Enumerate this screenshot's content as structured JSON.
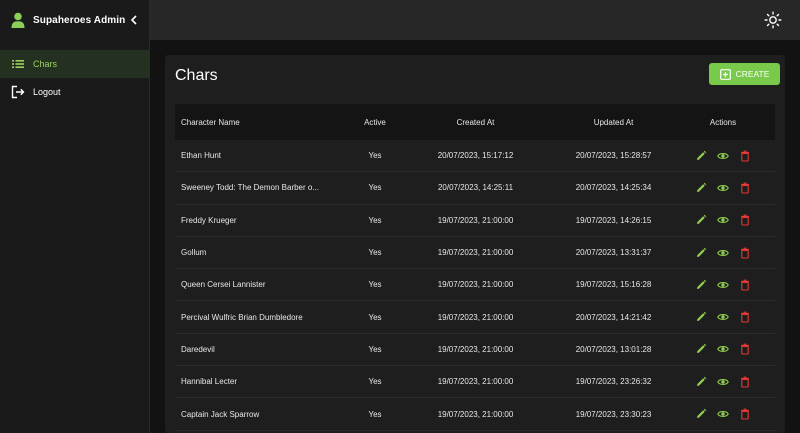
{
  "sidebar": {
    "title": "Supaheroes Admin",
    "items": [
      {
        "label": "Chars",
        "icon": "list-icon",
        "active": true
      },
      {
        "label": "Logout",
        "icon": "logout-icon",
        "active": false
      }
    ]
  },
  "header": {
    "theme_icon": "sun-icon"
  },
  "page": {
    "title": "Chars",
    "create_label": "CREATE"
  },
  "colors": {
    "accent": "#79c94a",
    "active_text": "#9ed35f",
    "edit": "#8fce4f",
    "show": "#8fce4f",
    "delete": "#e53935"
  },
  "table": {
    "columns": [
      "Character Name",
      "Active",
      "Created At",
      "Updated At",
      "Actions"
    ],
    "rows": [
      {
        "name": "Ethan Hunt",
        "active": "Yes",
        "created": "20/07/2023, 15:17:12",
        "updated": "20/07/2023, 15:28:57"
      },
      {
        "name": "Sweeney Todd: The Demon Barber o...",
        "active": "Yes",
        "created": "20/07/2023, 14:25:11",
        "updated": "20/07/2023, 14:25:34"
      },
      {
        "name": "Freddy Krueger",
        "active": "Yes",
        "created": "19/07/2023, 21:00:00",
        "updated": "19/07/2023, 14:26:15"
      },
      {
        "name": "Gollum",
        "active": "Yes",
        "created": "19/07/2023, 21:00:00",
        "updated": "20/07/2023, 13:31:37"
      },
      {
        "name": "Queen Cersei Lannister",
        "active": "Yes",
        "created": "19/07/2023, 21:00:00",
        "updated": "19/07/2023, 15:16:28"
      },
      {
        "name": "Percival Wulfric Brian Dumbledore",
        "active": "Yes",
        "created": "19/07/2023, 21:00:00",
        "updated": "20/07/2023, 14:21:42"
      },
      {
        "name": "Daredevil",
        "active": "Yes",
        "created": "19/07/2023, 21:00:00",
        "updated": "20/07/2023, 13:01:28"
      },
      {
        "name": "Hannibal Lecter",
        "active": "Yes",
        "created": "19/07/2023, 21:00:00",
        "updated": "19/07/2023, 23:26:32"
      },
      {
        "name": "Captain Jack Sparrow",
        "active": "Yes",
        "created": "19/07/2023, 21:00:00",
        "updated": "19/07/2023, 23:30:23"
      }
    ]
  }
}
